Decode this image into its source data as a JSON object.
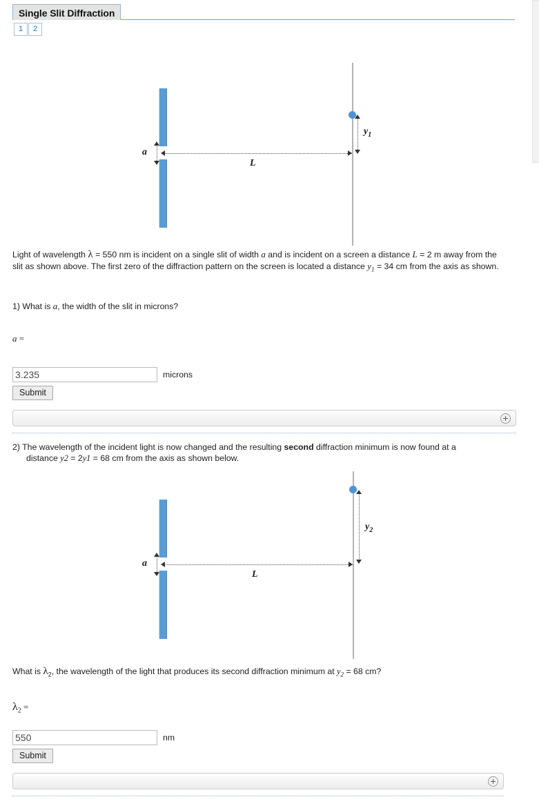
{
  "header": {
    "title": "Single Slit Diffraction",
    "page_buttons": [
      "1",
      "2"
    ]
  },
  "diagram1": {
    "label_a": "a",
    "label_L": "L",
    "label_y": "y",
    "label_y_sub": "1"
  },
  "diagram2": {
    "label_a": "a",
    "label_L": "L",
    "label_y": "y",
    "label_y_sub": "2"
  },
  "intro": {
    "part1": "Light of wavelength ",
    "lambda": "λ",
    "part2": " = 550 nm is incident on a single slit of width ",
    "var_a": "a",
    "part3": " and is incident on a screen a distance ",
    "var_L": "L",
    "part4": " = 2 m away from the slit as shown above. The first zero of the diffraction pattern on the screen is located a distance ",
    "var_y": "y",
    "var_y_sub": "1",
    "part5": " = 34 cm from the axis as shown."
  },
  "question1": {
    "prompt_pre": "1) What is ",
    "prompt_var": "a",
    "prompt_post": ", the width of the slit in microns?",
    "equation_var": "a",
    "equation_eq": " =",
    "answer_value": "3.235",
    "answer_placeholder": "",
    "unit": "microns",
    "submit_label": "Submit"
  },
  "question2": {
    "prompt_line1_pre": "2) The wavelength of the incident light is now changed and the resulting ",
    "prompt_bold": "second",
    "prompt_line1_post": " diffraction minimum is now found at a",
    "prompt_line2_pre": "distance ",
    "prompt_y2": "y",
    "prompt_y2_sub": "2",
    "prompt_line2_mid": " = 2",
    "prompt_y1": "y",
    "prompt_y1_sub": "1",
    "prompt_line2_post": " = 68 cm from the axis as shown below.",
    "final_pre": "What is ",
    "final_lambda": "λ",
    "final_lambda_sub": "2",
    "final_post": ", the wavelength of the light that produces its second diffraction minimum at ",
    "final_y": "y",
    "final_y_sub": "2",
    "final_end": " = 68 cm?",
    "equation_lambda": "λ",
    "equation_lambda_sub": "2",
    "equation_eq": " =",
    "answer_value": "550",
    "answer_placeholder": "",
    "unit": "nm",
    "submit_label": "Submit"
  },
  "colors": {
    "slit_blue": "#5b9bd5",
    "tab_border": "#9ab2c8",
    "link_blue": "#1f6fb5",
    "screen_gray": "#b3b3b3"
  }
}
